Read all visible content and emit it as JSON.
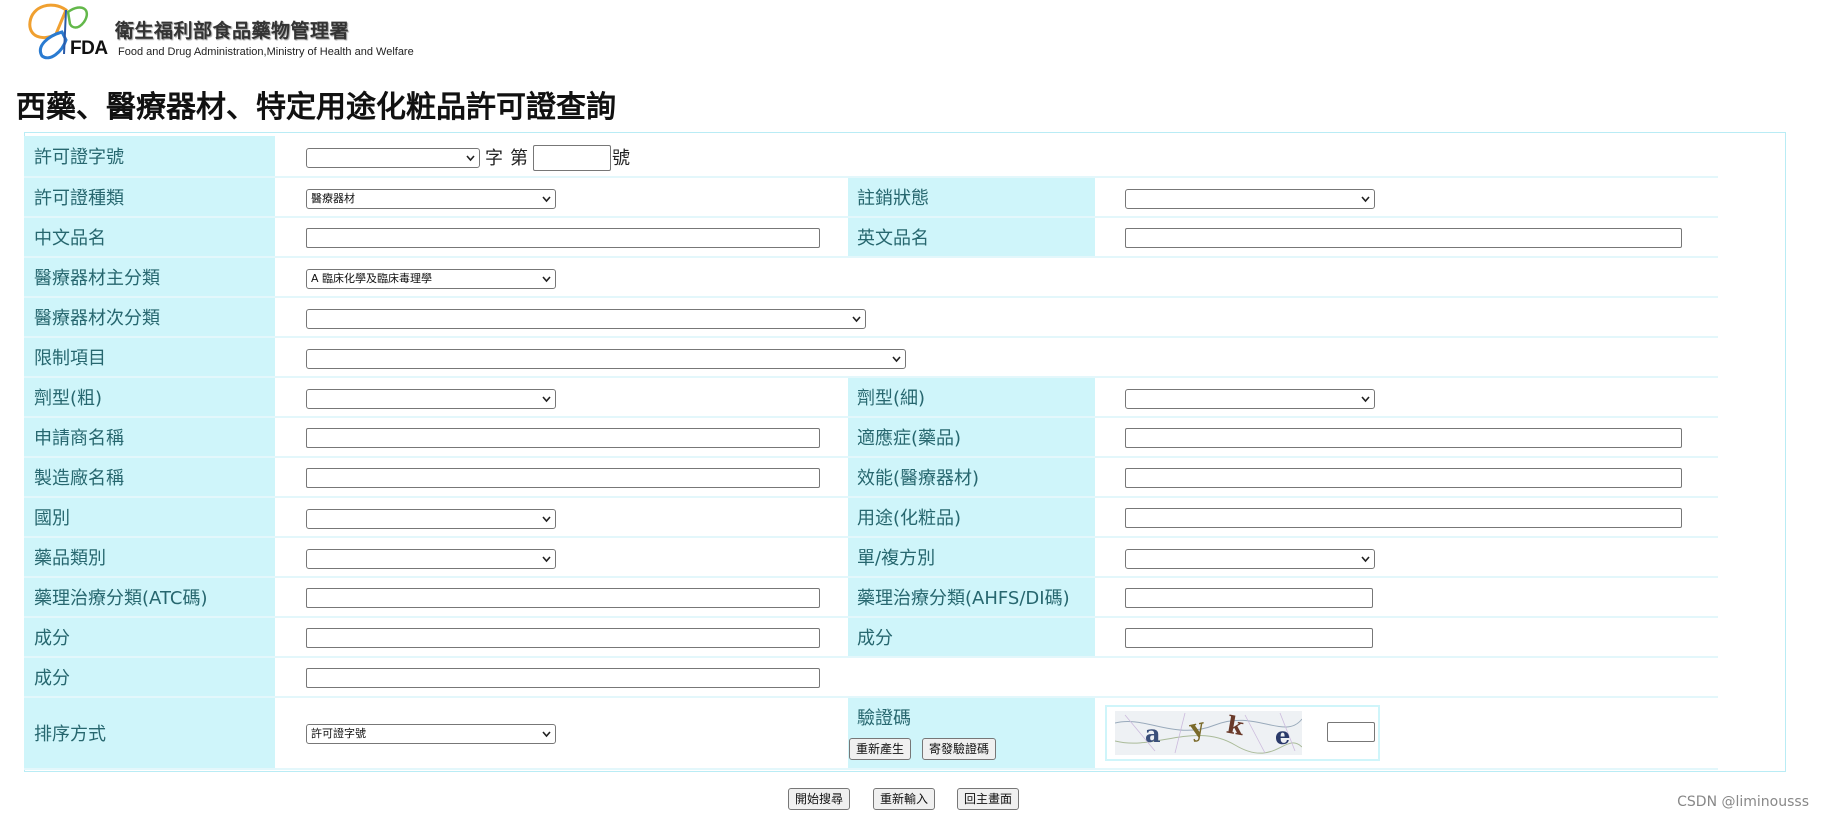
{
  "header": {
    "org_name_zh": "衛生福利部食品藥物管理署",
    "org_name_en": "Food and Drug Administration,Ministry of Health and Welfare",
    "logo_text": "FDA"
  },
  "page_title": "西藥、醫療器材、特定用途化粧品許可證查詢",
  "fields": {
    "license_no": {
      "label": "許可證字號",
      "value": "",
      "text_zi": "字",
      "text_di": "第",
      "text_hao": "號",
      "number_value": ""
    },
    "license_type": {
      "label": "許可證種類",
      "value": "醫療器材"
    },
    "cancel_status": {
      "label": "註銷狀態",
      "value": ""
    },
    "name_zh": {
      "label": "中文品名",
      "value": ""
    },
    "name_en": {
      "label": "英文品名",
      "value": ""
    },
    "device_main_class": {
      "label": "醫療器材主分類",
      "value": "A 臨床化學及臨床毒理學"
    },
    "device_sub_class": {
      "label": "醫療器材次分類",
      "value": ""
    },
    "restriction": {
      "label": "限制項目",
      "value": ""
    },
    "dosage_form_coarse": {
      "label": "劑型(粗)",
      "value": ""
    },
    "dosage_form_fine": {
      "label": "劑型(細)",
      "value": ""
    },
    "applicant_name": {
      "label": "申請商名稱",
      "value": ""
    },
    "indication": {
      "label": "適應症(藥品)",
      "value": ""
    },
    "manufacturer_name": {
      "label": "製造廠名稱",
      "value": ""
    },
    "efficacy": {
      "label": "效能(醫療器材)",
      "value": ""
    },
    "country": {
      "label": "國別",
      "value": ""
    },
    "cosmetic_use": {
      "label": "用途(化粧品)",
      "value": ""
    },
    "drug_category": {
      "label": "藥品類別",
      "value": ""
    },
    "single_compound": {
      "label": "單/複方別",
      "value": ""
    },
    "atc_code": {
      "label": "藥理治療分類(ATC碼)",
      "value": ""
    },
    "ahfs_code": {
      "label": "藥理治療分類(AHFS/DI碼)",
      "value": ""
    },
    "ingredient_1": {
      "label": "成分",
      "value": ""
    },
    "ingredient_2": {
      "label": "成分",
      "value": ""
    },
    "ingredient_3": {
      "label": "成分",
      "value": ""
    },
    "sort_order": {
      "label": "排序方式",
      "value": "許可證字號"
    },
    "captcha": {
      "label": "驗證碼",
      "regenerate_label": "重新產生",
      "send_label": "寄發驗證碼",
      "image_chars": [
        "a",
        "y",
        "k",
        "e"
      ],
      "value": ""
    }
  },
  "actions": {
    "search_label": "開始搜尋",
    "reset_label": "重新輸入",
    "home_label": "回主畫面"
  },
  "watermark": "CSDN @liminousss"
}
